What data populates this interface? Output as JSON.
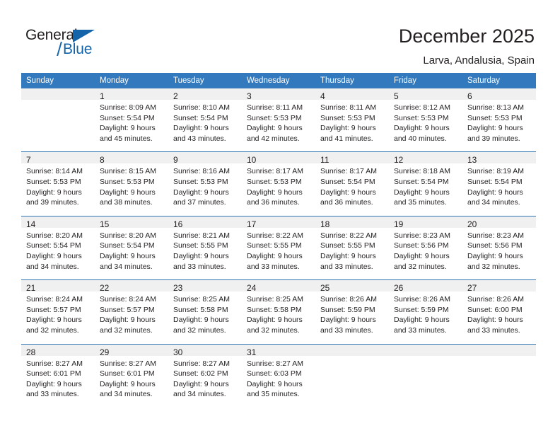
{
  "brand": {
    "name_part1": "General",
    "name_part2": "Blue",
    "accent_color": "#1464aa"
  },
  "header": {
    "title": "December 2025",
    "subtitle": "Larva, Andalusia, Spain"
  },
  "theme": {
    "header_blue": "#3279be",
    "separator_blue": "#2e75b6",
    "daynum_band": "#f0f0f0",
    "text": "#231f20"
  },
  "calendar": {
    "weekday_headers": [
      "Sunday",
      "Monday",
      "Tuesday",
      "Wednesday",
      "Thursday",
      "Friday",
      "Saturday"
    ],
    "weeks": [
      [
        {
          "day": "",
          "lines": []
        },
        {
          "day": "1",
          "lines": [
            "Sunrise: 8:09 AM",
            "Sunset: 5:54 PM",
            "Daylight: 9 hours",
            "and 45 minutes."
          ]
        },
        {
          "day": "2",
          "lines": [
            "Sunrise: 8:10 AM",
            "Sunset: 5:54 PM",
            "Daylight: 9 hours",
            "and 43 minutes."
          ]
        },
        {
          "day": "3",
          "lines": [
            "Sunrise: 8:11 AM",
            "Sunset: 5:53 PM",
            "Daylight: 9 hours",
            "and 42 minutes."
          ]
        },
        {
          "day": "4",
          "lines": [
            "Sunrise: 8:11 AM",
            "Sunset: 5:53 PM",
            "Daylight: 9 hours",
            "and 41 minutes."
          ]
        },
        {
          "day": "5",
          "lines": [
            "Sunrise: 8:12 AM",
            "Sunset: 5:53 PM",
            "Daylight: 9 hours",
            "and 40 minutes."
          ]
        },
        {
          "day": "6",
          "lines": [
            "Sunrise: 8:13 AM",
            "Sunset: 5:53 PM",
            "Daylight: 9 hours",
            "and 39 minutes."
          ]
        }
      ],
      [
        {
          "day": "7",
          "lines": [
            "Sunrise: 8:14 AM",
            "Sunset: 5:53 PM",
            "Daylight: 9 hours",
            "and 39 minutes."
          ]
        },
        {
          "day": "8",
          "lines": [
            "Sunrise: 8:15 AM",
            "Sunset: 5:53 PM",
            "Daylight: 9 hours",
            "and 38 minutes."
          ]
        },
        {
          "day": "9",
          "lines": [
            "Sunrise: 8:16 AM",
            "Sunset: 5:53 PM",
            "Daylight: 9 hours",
            "and 37 minutes."
          ]
        },
        {
          "day": "10",
          "lines": [
            "Sunrise: 8:17 AM",
            "Sunset: 5:53 PM",
            "Daylight: 9 hours",
            "and 36 minutes."
          ]
        },
        {
          "day": "11",
          "lines": [
            "Sunrise: 8:17 AM",
            "Sunset: 5:54 PM",
            "Daylight: 9 hours",
            "and 36 minutes."
          ]
        },
        {
          "day": "12",
          "lines": [
            "Sunrise: 8:18 AM",
            "Sunset: 5:54 PM",
            "Daylight: 9 hours",
            "and 35 minutes."
          ]
        },
        {
          "day": "13",
          "lines": [
            "Sunrise: 8:19 AM",
            "Sunset: 5:54 PM",
            "Daylight: 9 hours",
            "and 34 minutes."
          ]
        }
      ],
      [
        {
          "day": "14",
          "lines": [
            "Sunrise: 8:20 AM",
            "Sunset: 5:54 PM",
            "Daylight: 9 hours",
            "and 34 minutes."
          ]
        },
        {
          "day": "15",
          "lines": [
            "Sunrise: 8:20 AM",
            "Sunset: 5:54 PM",
            "Daylight: 9 hours",
            "and 34 minutes."
          ]
        },
        {
          "day": "16",
          "lines": [
            "Sunrise: 8:21 AM",
            "Sunset: 5:55 PM",
            "Daylight: 9 hours",
            "and 33 minutes."
          ]
        },
        {
          "day": "17",
          "lines": [
            "Sunrise: 8:22 AM",
            "Sunset: 5:55 PM",
            "Daylight: 9 hours",
            "and 33 minutes."
          ]
        },
        {
          "day": "18",
          "lines": [
            "Sunrise: 8:22 AM",
            "Sunset: 5:55 PM",
            "Daylight: 9 hours",
            "and 33 minutes."
          ]
        },
        {
          "day": "19",
          "lines": [
            "Sunrise: 8:23 AM",
            "Sunset: 5:56 PM",
            "Daylight: 9 hours",
            "and 32 minutes."
          ]
        },
        {
          "day": "20",
          "lines": [
            "Sunrise: 8:23 AM",
            "Sunset: 5:56 PM",
            "Daylight: 9 hours",
            "and 32 minutes."
          ]
        }
      ],
      [
        {
          "day": "21",
          "lines": [
            "Sunrise: 8:24 AM",
            "Sunset: 5:57 PM",
            "Daylight: 9 hours",
            "and 32 minutes."
          ]
        },
        {
          "day": "22",
          "lines": [
            "Sunrise: 8:24 AM",
            "Sunset: 5:57 PM",
            "Daylight: 9 hours",
            "and 32 minutes."
          ]
        },
        {
          "day": "23",
          "lines": [
            "Sunrise: 8:25 AM",
            "Sunset: 5:58 PM",
            "Daylight: 9 hours",
            "and 32 minutes."
          ]
        },
        {
          "day": "24",
          "lines": [
            "Sunrise: 8:25 AM",
            "Sunset: 5:58 PM",
            "Daylight: 9 hours",
            "and 32 minutes."
          ]
        },
        {
          "day": "25",
          "lines": [
            "Sunrise: 8:26 AM",
            "Sunset: 5:59 PM",
            "Daylight: 9 hours",
            "and 33 minutes."
          ]
        },
        {
          "day": "26",
          "lines": [
            "Sunrise: 8:26 AM",
            "Sunset: 5:59 PM",
            "Daylight: 9 hours",
            "and 33 minutes."
          ]
        },
        {
          "day": "27",
          "lines": [
            "Sunrise: 8:26 AM",
            "Sunset: 6:00 PM",
            "Daylight: 9 hours",
            "and 33 minutes."
          ]
        }
      ],
      [
        {
          "day": "28",
          "lines": [
            "Sunrise: 8:27 AM",
            "Sunset: 6:01 PM",
            "Daylight: 9 hours",
            "and 33 minutes."
          ]
        },
        {
          "day": "29",
          "lines": [
            "Sunrise: 8:27 AM",
            "Sunset: 6:01 PM",
            "Daylight: 9 hours",
            "and 34 minutes."
          ]
        },
        {
          "day": "30",
          "lines": [
            "Sunrise: 8:27 AM",
            "Sunset: 6:02 PM",
            "Daylight: 9 hours",
            "and 34 minutes."
          ]
        },
        {
          "day": "31",
          "lines": [
            "Sunrise: 8:27 AM",
            "Sunset: 6:03 PM",
            "Daylight: 9 hours",
            "and 35 minutes."
          ]
        },
        {
          "day": "",
          "lines": []
        },
        {
          "day": "",
          "lines": []
        },
        {
          "day": "",
          "lines": []
        }
      ]
    ]
  }
}
